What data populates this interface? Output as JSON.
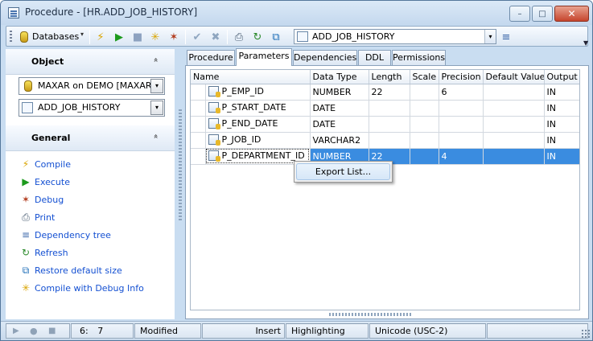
{
  "window": {
    "title": "Procedure - [HR.ADD_JOB_HISTORY]",
    "min_glyph": "–",
    "max_glyph": "□",
    "close_glyph": "✕"
  },
  "toolbar": {
    "databases_label": "Databases",
    "dropdown_glyph": "▾",
    "object_combo_value": "ADD_JOB_HISTORY",
    "icons": {
      "compile": "⚡",
      "execute": "▶",
      "save": "■",
      "compile_debug": "✳",
      "debug": "✶",
      "commit": "✔",
      "rollback": "✖",
      "print": "⎙",
      "refresh": "↻",
      "restore_size": "⧉",
      "dependency_tree": "≡"
    },
    "chevron": "▼"
  },
  "left_panel": {
    "object_section": {
      "title": "Object",
      "collapse_glyph": "»",
      "database_select": "MAXAR on DEMO [MAXAR]",
      "object_select": "ADD_JOB_HISTORY"
    },
    "general_section": {
      "title": "General",
      "collapse_glyph": "»",
      "actions": [
        {
          "label": "Compile",
          "icon": "⚡",
          "color": "#d9a400"
        },
        {
          "label": "Execute",
          "icon": "▶",
          "color": "#1c9a1c"
        },
        {
          "label": "Debug",
          "icon": "✶",
          "color": "#b23c1e"
        },
        {
          "label": "Print",
          "icon": "⎙",
          "color": "#4d6075"
        },
        {
          "label": "Dependency tree",
          "icon": "≡",
          "color": "#3a66a8"
        },
        {
          "label": "Refresh",
          "icon": "↻",
          "color": "#2b8a2b"
        },
        {
          "label": "Restore default size",
          "icon": "⧉",
          "color": "#1f6fb8"
        },
        {
          "label": "Compile with Debug Info",
          "icon": "✳",
          "color": "#d9a400"
        }
      ]
    }
  },
  "tabs": [
    {
      "label": "Procedure",
      "active": false
    },
    {
      "label": "Parameters",
      "active": true
    },
    {
      "label": "Dependencies",
      "active": false
    },
    {
      "label": "DDL",
      "active": false
    },
    {
      "label": "Permissions",
      "active": false
    }
  ],
  "grid": {
    "columns": [
      "Name",
      "Data Type",
      "Length",
      "Scale",
      "Precision",
      "Default Value",
      "Output"
    ],
    "rows": [
      {
        "name": "P_EMP_ID",
        "data_type": "NUMBER",
        "length": "22",
        "scale": "",
        "precision": "6",
        "default_value": "",
        "output": "IN",
        "selected": false
      },
      {
        "name": "P_START_DATE",
        "data_type": "DATE",
        "length": "",
        "scale": "",
        "precision": "",
        "default_value": "",
        "output": "IN",
        "selected": false
      },
      {
        "name": "P_END_DATE",
        "data_type": "DATE",
        "length": "",
        "scale": "",
        "precision": "",
        "default_value": "",
        "output": "IN",
        "selected": false
      },
      {
        "name": "P_JOB_ID",
        "data_type": "VARCHAR2",
        "length": "",
        "scale": "",
        "precision": "",
        "default_value": "",
        "output": "IN",
        "selected": false
      },
      {
        "name": "P_DEPARTMENT_ID",
        "data_type": "NUMBER",
        "length": "22",
        "scale": "",
        "precision": "4",
        "default_value": "",
        "output": "IN",
        "selected": true
      }
    ]
  },
  "context_menu": {
    "items": [
      "Export List..."
    ]
  },
  "statusbar": {
    "play_glyph": "▶",
    "record_glyph": "●",
    "stop_glyph": "■",
    "cursor_line": "6:",
    "cursor_col": "7",
    "modified": "Modified",
    "insert_mode": "Insert",
    "highlighting": "Highlighting",
    "encoding": "Unicode (USC-2)"
  },
  "colors": {
    "selection": "#3a8ce0",
    "link": "#1450d2",
    "frame": "#c9ddf1"
  }
}
